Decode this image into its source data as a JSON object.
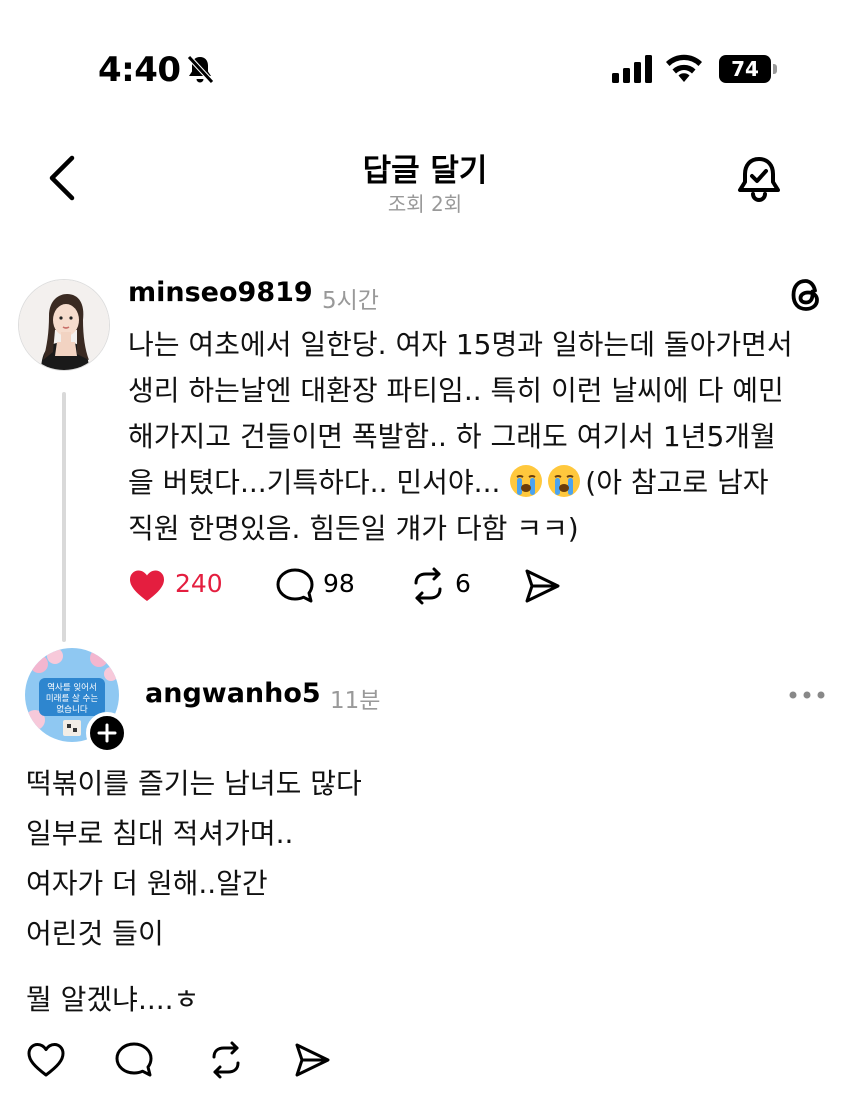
{
  "status_bar": {
    "time": "4:40",
    "battery_level": "74"
  },
  "header": {
    "title": "답글 달기",
    "subtitle": "조회 2회"
  },
  "post": {
    "username": "minseo9819",
    "time": "5시간",
    "lines": [
      "나는 여초에서 일한당. 여자 15명과 일하는데 돌아가면서",
      "생리 하는날엔 대환장 파티임.. 특히 이런 날씨에 다 예민",
      "해가지고 건들이면 폭발함.. 하 그래도 여기서 1년5개월",
      "을 버텼다...기특하다.. 민서야...",
      "(아 참고로 남자",
      "직원 한명있음. 힘든일 걔가 다함 ㅋㅋ)"
    ],
    "likes": "240",
    "replies": "98",
    "reposts": "6",
    "liked": true,
    "accent_color": "#e41e3f"
  },
  "avatar2_text": {
    "line1": "역사를 잊어서",
    "line2": "미래를 살 수는",
    "line3": "없습니다"
  },
  "reply": {
    "username": "angwanho5",
    "time": "11분",
    "lines": [
      "떡볶이를 즐기는 남녀도 많다",
      "일부로 침대 적셔가며..",
      "여자가 더 원해..알간",
      "어린것 들이",
      "뭘 알겠냐....ㅎ"
    ]
  }
}
